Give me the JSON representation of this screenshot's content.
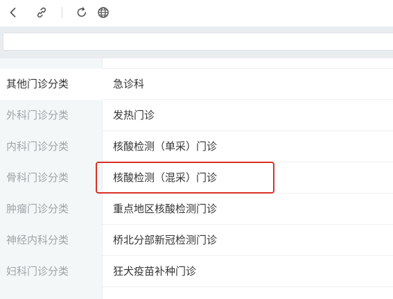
{
  "toolbar": {
    "icons": [
      "back-icon",
      "link-icon",
      "refresh-icon",
      "globe-icon"
    ]
  },
  "address_bar": {
    "value": ""
  },
  "categories": [
    "",
    "其他门诊分类",
    "外科门诊分类",
    "内科门诊分类",
    "骨科门诊分类",
    "肿瘤门诊分类",
    "神经内科分类",
    "妇科门诊分类"
  ],
  "departments": [
    "",
    "急诊科",
    "发热门诊",
    "核酸检测（单采）门诊",
    "核酸检测（混采）门诊",
    "重点地区核酸检测门诊",
    "桥北分部新冠检测门诊",
    "狂犬疫苗补种门诊"
  ],
  "colors": {
    "highlight_border": "#d93025",
    "sidebar_bg": "#f4f7f7",
    "inactive_text": "#a0a4a8",
    "active_text": "#333333"
  }
}
